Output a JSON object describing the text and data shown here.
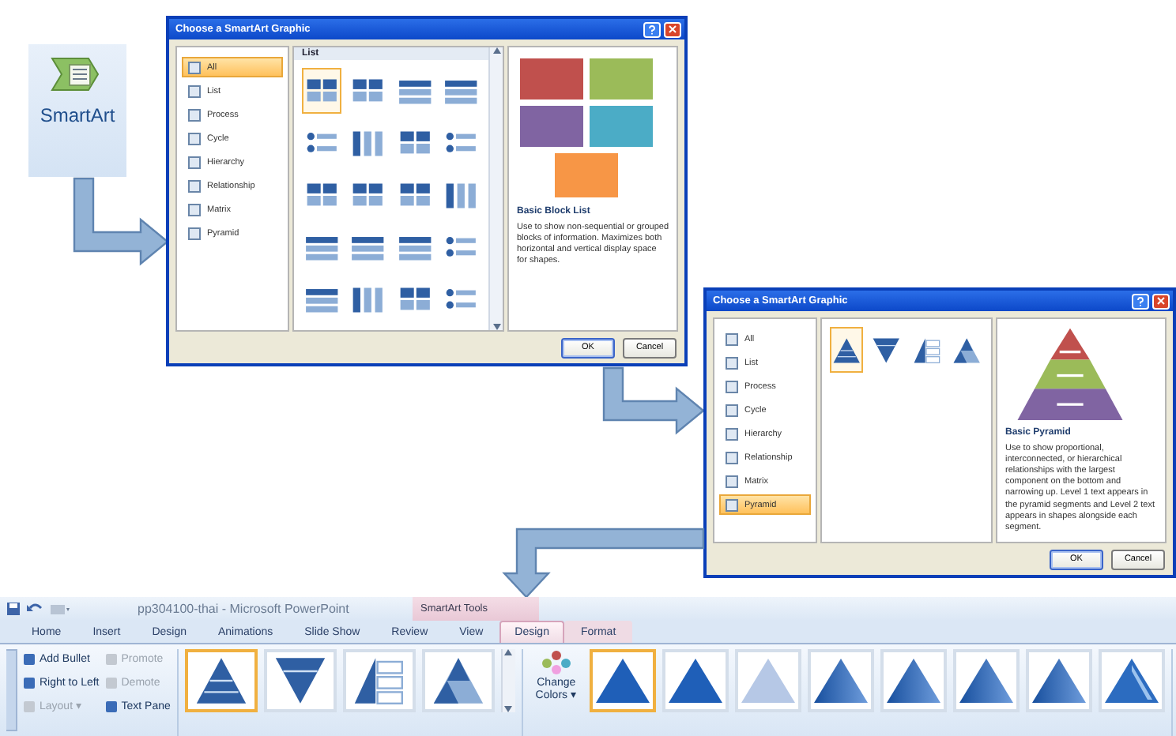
{
  "smartart_button": {
    "label": "SmartArt"
  },
  "dialogs": [
    {
      "title": "Choose a SmartArt Graphic",
      "categories": [
        {
          "label": "All",
          "selected": true
        },
        {
          "label": "List",
          "selected": false
        },
        {
          "label": "Process",
          "selected": false
        },
        {
          "label": "Cycle",
          "selected": false
        },
        {
          "label": "Hierarchy",
          "selected": false
        },
        {
          "label": "Relationship",
          "selected": false
        },
        {
          "label": "Matrix",
          "selected": false
        },
        {
          "label": "Pyramid",
          "selected": false
        }
      ],
      "gallery_header": "List",
      "layouts": [
        {
          "kind": "blocks",
          "selected": true
        },
        {
          "kind": "blocks",
          "selected": false
        },
        {
          "kind": "bars",
          "selected": false
        },
        {
          "kind": "bars",
          "selected": false
        },
        {
          "kind": "rows",
          "selected": false
        },
        {
          "kind": "columns",
          "selected": false
        },
        {
          "kind": "blocks",
          "selected": false
        },
        {
          "kind": "rows",
          "selected": false
        },
        {
          "kind": "blocks",
          "selected": false
        },
        {
          "kind": "blocks",
          "selected": false
        },
        {
          "kind": "blocks",
          "selected": false
        },
        {
          "kind": "columns",
          "selected": false
        },
        {
          "kind": "bars",
          "selected": false
        },
        {
          "kind": "bars",
          "selected": false
        },
        {
          "kind": "bars",
          "selected": false
        },
        {
          "kind": "rows",
          "selected": false
        },
        {
          "kind": "bars",
          "selected": false
        },
        {
          "kind": "columns",
          "selected": false
        },
        {
          "kind": "blocks",
          "selected": false
        },
        {
          "kind": "rows",
          "selected": false
        }
      ],
      "preview": {
        "kind": "block-list",
        "title": "Basic Block List",
        "description": "Use to show non-sequential or grouped blocks of information. Maximizes both horizontal and vertical display space for shapes."
      },
      "buttons": [
        {
          "label": "OK",
          "default": true
        },
        {
          "label": "Cancel",
          "default": false
        }
      ]
    },
    {
      "title": "Choose a SmartArt Graphic",
      "categories": [
        {
          "label": "All",
          "selected": false
        },
        {
          "label": "List",
          "selected": false
        },
        {
          "label": "Process",
          "selected": false
        },
        {
          "label": "Cycle",
          "selected": false
        },
        {
          "label": "Hierarchy",
          "selected": false
        },
        {
          "label": "Relationship",
          "selected": false
        },
        {
          "label": "Matrix",
          "selected": false
        },
        {
          "label": "Pyramid",
          "selected": true
        }
      ],
      "layouts": [
        {
          "kind": "pyramid",
          "selected": true
        },
        {
          "kind": "inverted",
          "selected": false
        },
        {
          "kind": "list-pyramid",
          "selected": false
        },
        {
          "kind": "segmented",
          "selected": false
        }
      ],
      "preview": {
        "kind": "pyramid",
        "title": "Basic Pyramid",
        "description": "Use to show proportional, interconnected, or hierarchical relationships with the largest component on the bottom and narrowing up. Level 1 text appears in the pyramid segments and Level 2 text appears in shapes alongside each segment."
      },
      "buttons": [
        {
          "label": "OK",
          "default": true
        },
        {
          "label": "Cancel",
          "default": false
        }
      ]
    }
  ],
  "ribbon": {
    "title": "pp304100-thai - Microsoft PowerPoint",
    "context_title": "SmartArt Tools",
    "tabs": [
      {
        "label": "Home",
        "selected": false,
        "context": false
      },
      {
        "label": "Insert",
        "selected": false,
        "context": false
      },
      {
        "label": "Design",
        "selected": false,
        "context": false
      },
      {
        "label": "Animations",
        "selected": false,
        "context": false
      },
      {
        "label": "Slide Show",
        "selected": false,
        "context": false
      },
      {
        "label": "Review",
        "selected": false,
        "context": false
      },
      {
        "label": "View",
        "selected": false,
        "context": false
      },
      {
        "label": "Design",
        "selected": true,
        "context": true
      },
      {
        "label": "Format",
        "selected": false,
        "context": true
      }
    ],
    "graphic_buttons": [
      {
        "label": "Add Bullet",
        "disabled": false
      },
      {
        "label": "Right to Left",
        "disabled": false
      },
      {
        "label": "Layout ▾",
        "disabled": true
      },
      {
        "label": "Promote",
        "disabled": true
      },
      {
        "label": "Demote",
        "disabled": true
      },
      {
        "label": "Text Pane",
        "disabled": false
      }
    ],
    "layouts": [
      {
        "kind": "pyramid",
        "selected": true
      },
      {
        "kind": "inverted",
        "selected": false
      },
      {
        "kind": "list-pyramid",
        "selected": false
      },
      {
        "kind": "segmented",
        "selected": false
      }
    ],
    "change_colors": "Change Colors ▾",
    "styles": [
      {
        "kind": "flat",
        "selected": true
      },
      {
        "kind": "flat",
        "selected": false
      },
      {
        "kind": "pale",
        "selected": false
      },
      {
        "kind": "gradient",
        "selected": false
      },
      {
        "kind": "gradient",
        "selected": false
      },
      {
        "kind": "gradient",
        "selected": false
      },
      {
        "kind": "gradient",
        "selected": false
      },
      {
        "kind": "beveled",
        "selected": false
      }
    ]
  }
}
